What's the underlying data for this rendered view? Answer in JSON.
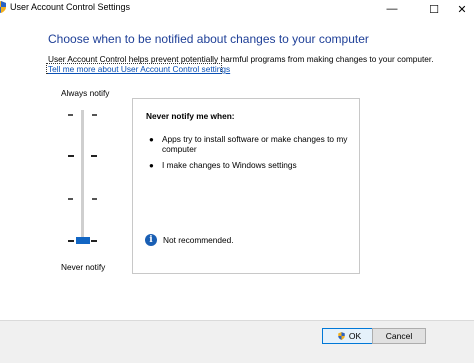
{
  "window": {
    "title": "User Account Control Settings",
    "controls": {
      "minimize": "—",
      "maximize": "☐",
      "close": "✕"
    }
  },
  "main": {
    "heading": "Choose when to be notified about changes to your computer",
    "description": "User Account Control helps prevent potentially harmful programs from making changes to your computer.",
    "link": "Tell me more about User Account Control settings"
  },
  "slider": {
    "top_label": "Always notify",
    "bottom_label": "Never notify",
    "level_index": 0,
    "level_count": 4,
    "accent_color": "#1266c4"
  },
  "panel": {
    "title": "Never notify me when:",
    "bullets": [
      "Apps try to install software or make changes to my computer",
      "I make changes to Windows settings"
    ],
    "recommendation_icon": "info-icon",
    "recommendation": "Not recommended."
  },
  "footer": {
    "ok_label": "OK",
    "ok_icon": "uac-shield-icon",
    "cancel_label": "Cancel"
  },
  "colors": {
    "heading": "#1e3f97",
    "link": "#0a50b5",
    "info_icon": "#1a5fb4"
  }
}
